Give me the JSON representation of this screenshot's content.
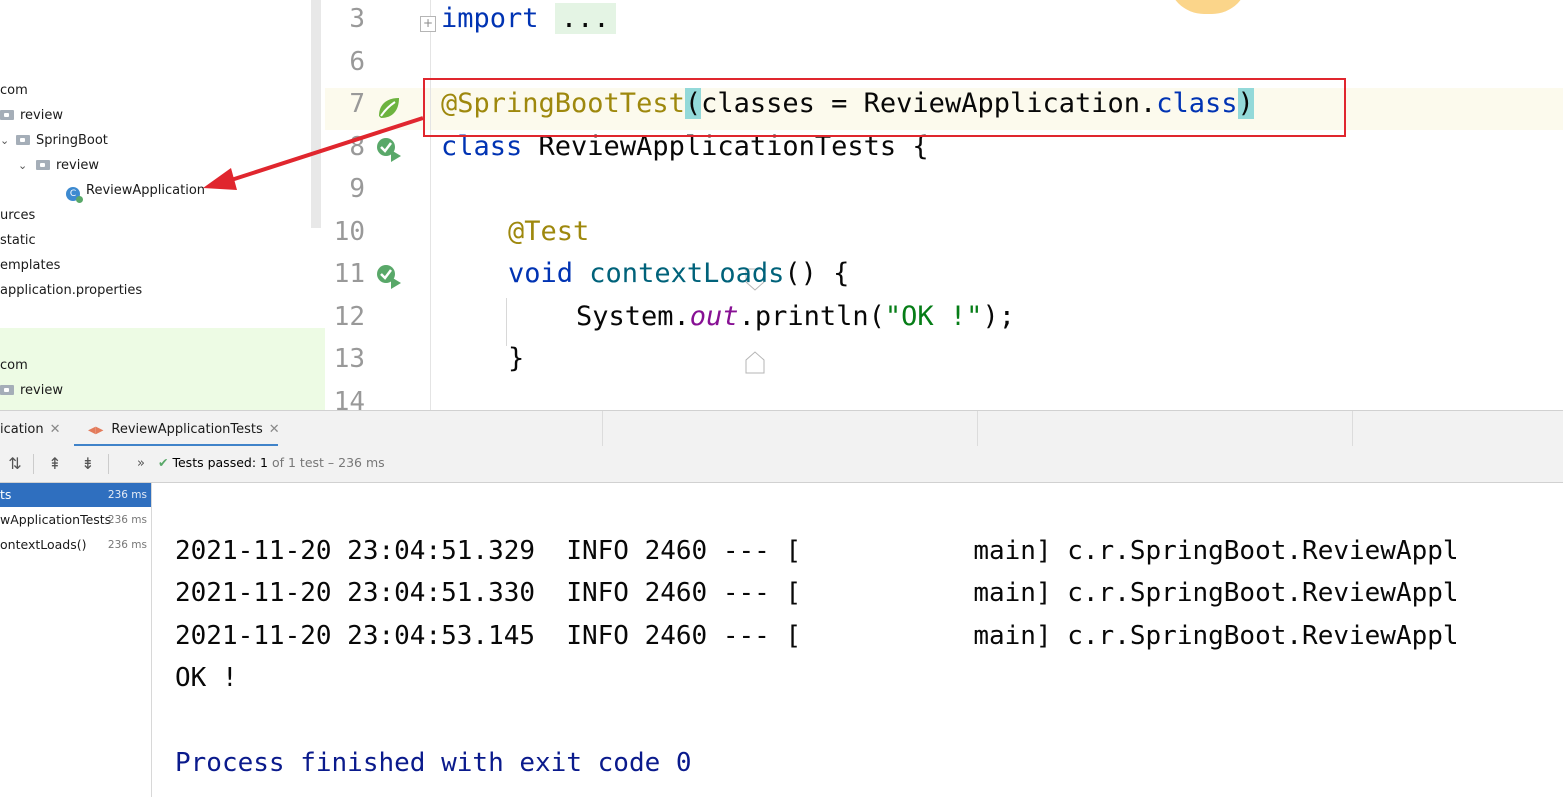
{
  "project_tree": {
    "items": [
      {
        "label": "com",
        "indent": 0,
        "icon": "none"
      },
      {
        "label": "review",
        "indent": 0,
        "icon": "folder-icon"
      },
      {
        "label": "SpringBoot",
        "indent": 1,
        "icon": "folder-icon"
      },
      {
        "label": "review",
        "indent": 2,
        "icon": "folder-icon"
      },
      {
        "label": "ReviewApplication",
        "indent": 3,
        "icon": "spring-class-icon"
      },
      {
        "label": "urces",
        "indent": 0,
        "icon": "none"
      },
      {
        "label": "static",
        "indent": 0,
        "icon": "none"
      },
      {
        "label": "emplates",
        "indent": 0,
        "icon": "none"
      },
      {
        "label": "application.properties",
        "indent": 0,
        "icon": "none"
      },
      {
        "label": "com",
        "indent": 0,
        "icon": "none"
      },
      {
        "label": "review",
        "indent": 0,
        "icon": "folder-icon"
      }
    ]
  },
  "editor": {
    "line_numbers": [
      "3",
      "6",
      "7",
      "8",
      "9",
      "10",
      "11",
      "12",
      "13",
      "14"
    ],
    "line3": {
      "kw": "import",
      "folded": "..."
    },
    "line7": {
      "ann": "@SpringBootTest",
      "open": "(",
      "mid": "classes = ReviewApplication.",
      "kw": "class",
      "close": ")"
    },
    "line8": {
      "kw": "class",
      "rest": " ReviewApplicationTests {"
    },
    "line10": {
      "ann": "@Test"
    },
    "line11": {
      "kw": "void",
      "fn": "contextLoads",
      "rest": "() {"
    },
    "line12": {
      "pre": "System.",
      "fld": "out",
      "mid": ".println(",
      "str": "\"OK !\"",
      "post": ");"
    },
    "line13": {
      "text": "}"
    }
  },
  "bottom_tabs": [
    {
      "label": "ication",
      "active": false
    },
    {
      "label": "ReviewApplicationTests",
      "active": true
    }
  ],
  "toolbar": {
    "status_label": "Tests passed:",
    "status_count": "1",
    "status_rest": "of 1 test – 236 ms"
  },
  "results": [
    {
      "label": "ts",
      "time": "236 ms",
      "selected": true
    },
    {
      "label": "wApplicationTests",
      "time": "236 ms",
      "selected": false
    },
    {
      "label": "ontextLoads()",
      "time": "236 ms",
      "selected": false
    }
  ],
  "console": {
    "lines": [
      "2021-11-20 23:04:51.329  INFO 2460 --- [           main] c.r.SpringBoot.ReviewAppl",
      "2021-11-20 23:04:51.330  INFO 2460 --- [           main] c.r.SpringBoot.ReviewAppl",
      "2021-11-20 23:04:53.145  INFO 2460 --- [           main] c.r.SpringBoot.ReviewAppl",
      "OK !"
    ],
    "exit_message": "Process finished with exit code 0"
  },
  "colors": {
    "highlight_box": "#e0262e",
    "arrow": "#e0262e",
    "selected_row": "#2f6fbf",
    "keyword": "#0033b3",
    "annotation": "#9e880d"
  }
}
